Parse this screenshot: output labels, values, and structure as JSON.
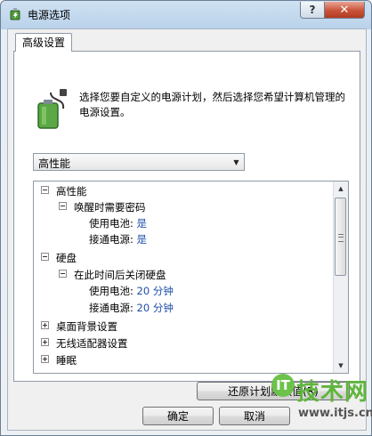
{
  "window": {
    "title": "电源选项",
    "help_glyph": "?",
    "close_glyph": "✕"
  },
  "tab": {
    "label": "高级设置"
  },
  "intro": {
    "text": "选择您要自定义的电源计划，然后选择您希望计算机管理的电源设置。"
  },
  "plan_select": {
    "value": "高性能",
    "arrow": "▼"
  },
  "tree": {
    "rows": [
      {
        "label": "高性能",
        "value": ""
      },
      {
        "label": "唤醒时需要密码",
        "value": ""
      },
      {
        "label": "使用电池: ",
        "value": "是"
      },
      {
        "label": "接通电源: ",
        "value": "是"
      },
      {
        "label": "硬盘",
        "value": ""
      },
      {
        "label": "在此时间后关闭硬盘",
        "value": ""
      },
      {
        "label": "使用电池: ",
        "value": "20 分钟"
      },
      {
        "label": "接通电源: ",
        "value": "20 分钟"
      },
      {
        "label": "桌面背景设置",
        "value": ""
      },
      {
        "label": "无线适配器设置",
        "value": ""
      },
      {
        "label": "睡眠",
        "value": ""
      }
    ],
    "scroll_up": "▲",
    "scroll_down": "▼"
  },
  "buttons": {
    "restore": "还原计划默认值(R)",
    "ok": "确定",
    "cancel": "取消"
  },
  "watermark": {
    "logo": "IT",
    "text": "技术网",
    "url": "www.itjs.cn"
  }
}
